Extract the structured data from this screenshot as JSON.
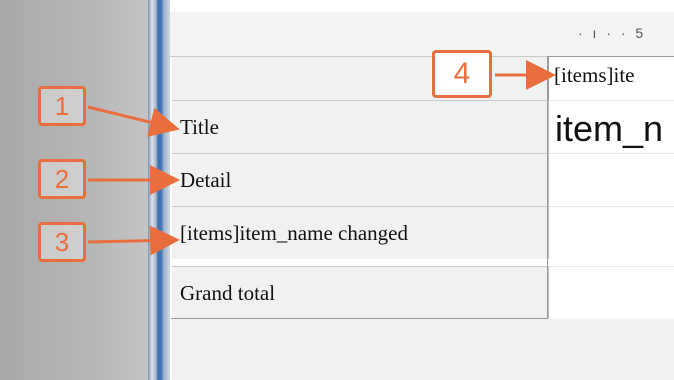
{
  "ruler": {
    "ticks": "· ı · · 5"
  },
  "report_sections": [
    {
      "label": "Title"
    },
    {
      "label": "Detail"
    },
    {
      "label": "[items]item_name changed"
    },
    {
      "label": "Grand total"
    }
  ],
  "column_header_field": "[items]ite",
  "title_field_preview": "item_n",
  "callouts": [
    "1",
    "2",
    "3",
    "4"
  ],
  "colors": {
    "accent": "#e86f3d",
    "blue_strip": "#3f72b2"
  }
}
